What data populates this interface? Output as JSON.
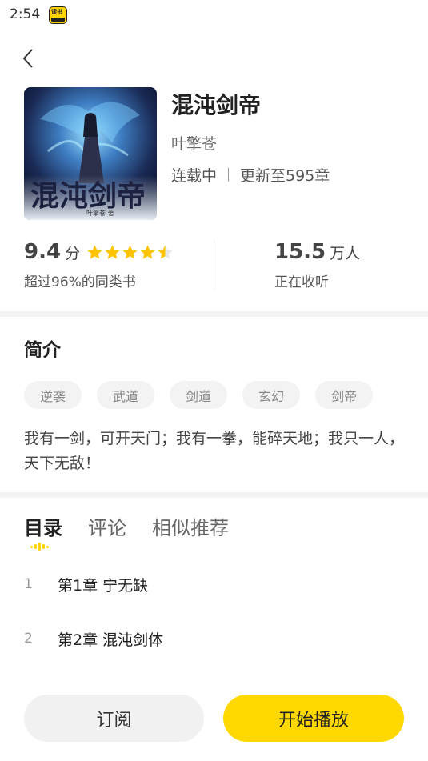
{
  "status_bar": {
    "time": "2:54",
    "app_icon": "novel-app-icon"
  },
  "header": {
    "back_icon": "chevron-left-icon"
  },
  "book": {
    "title": "混沌剑帝",
    "author": "叶擎苍",
    "status": "连载中",
    "update": "更新至595章",
    "cover_title_art": "混沌剑帝"
  },
  "stats": {
    "rating_value": "9.4",
    "rating_unit": "分",
    "stars": 4.5,
    "rating_sub": "超过96%的同类书",
    "listeners_value": "15.5",
    "listeners_unit": "万人",
    "listeners_sub": "正在收听"
  },
  "intro": {
    "heading": "简介",
    "tags": [
      "逆袭",
      "武道",
      "剑道",
      "玄幻",
      "剑帝"
    ],
    "text": "我有一剑，可开天门；我有一拳，能碎天地；我只一人，天下无敌！"
  },
  "tabs": {
    "items": [
      "目录",
      "评论",
      "相似推荐"
    ],
    "active": 0
  },
  "chapters": [
    {
      "num": "1",
      "title": "第1章 宁无缺"
    },
    {
      "num": "2",
      "title": "第2章 混沌剑体"
    }
  ],
  "actions": {
    "subscribe": "订阅",
    "play": "开始播放"
  },
  "colors": {
    "accent": "#ffd800",
    "tag_bg": "#f3f3f3",
    "star": "#ffc400"
  }
}
